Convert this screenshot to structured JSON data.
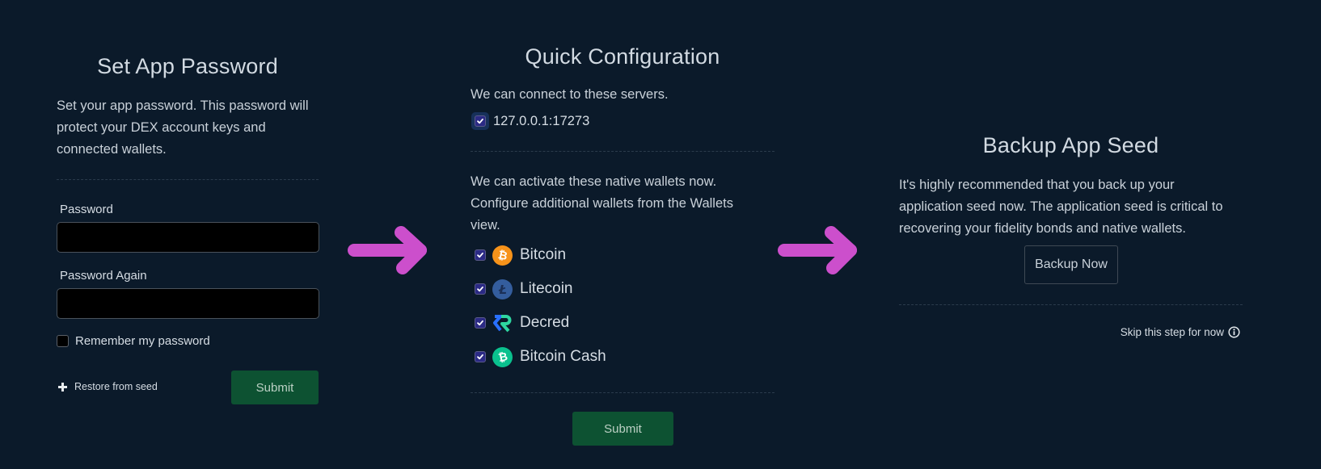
{
  "password_panel": {
    "title": "Set App Password",
    "description": "Set your app password. This password will protect your DEX account keys and connected wallets.",
    "description_lines": [
      "Set your app password. This password will",
      "protect your DEX account keys and",
      "connected wallets."
    ],
    "password_label": "Password",
    "password_value": "",
    "password_again_label": "Password Again",
    "password_again_value": "",
    "remember_label": "Remember my password",
    "remember_checked": false,
    "restore_label": "Restore from seed",
    "submit_label": "Submit"
  },
  "quick_config_panel": {
    "title": "Quick Configuration",
    "servers_intro": "We can connect to these servers.",
    "servers": [
      {
        "address": "127.0.0.1:17273",
        "checked": true
      }
    ],
    "wallets_intro_lines": [
      "We can activate these native wallets now.",
      "Configure additional wallets from the Wallets",
      "view."
    ],
    "wallets": [
      {
        "name": "Bitcoin",
        "icon": "bitcoin-icon",
        "color": "#f7931a",
        "checked": true
      },
      {
        "name": "Litecoin",
        "icon": "litecoin-icon",
        "color": "#345d9d",
        "checked": true
      },
      {
        "name": "Decred",
        "icon": "decred-icon",
        "color": "#2ed6a1",
        "checked": true
      },
      {
        "name": "Bitcoin Cash",
        "icon": "bitcoin-cash-icon",
        "color": "#0ac18e",
        "checked": true
      }
    ],
    "submit_label": "Submit"
  },
  "backup_panel": {
    "title": "Backup App Seed",
    "description_lines": [
      "It's highly recommended that you back up your",
      "application seed now. The application seed is critical to",
      "recovering your fidelity bonds and native wallets."
    ],
    "backup_button_label": "Backup Now",
    "skip_label": "Skip this step for now"
  },
  "colors": {
    "background": "#0b1a2a",
    "submit_green": "#0d5232",
    "checkbox_indigo": "#2b2a85",
    "arrow_magenta": "#cc4fcc"
  }
}
